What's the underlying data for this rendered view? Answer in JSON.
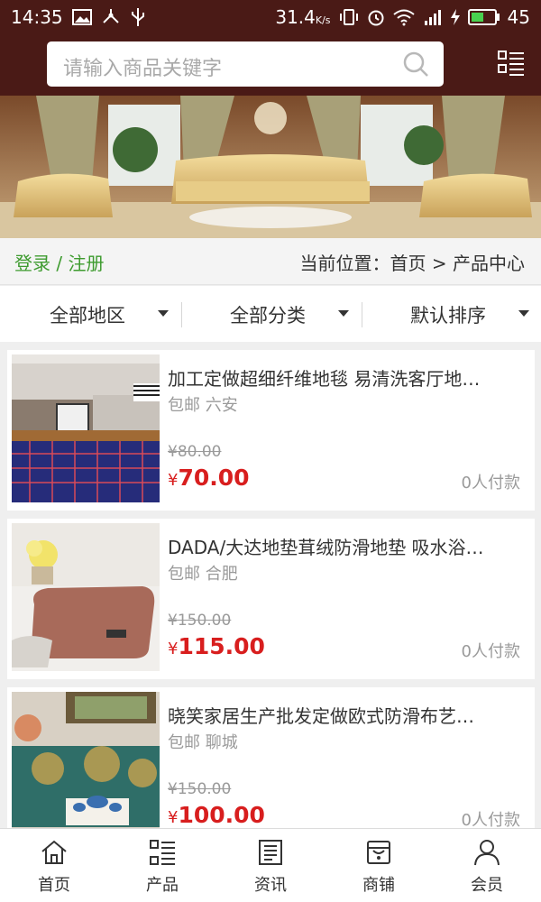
{
  "status_bar": {
    "time": "14:35",
    "speed": "31.4",
    "speed_unit": "K/s",
    "battery": "45"
  },
  "search": {
    "placeholder": "请输入商品关键字"
  },
  "auth": {
    "login_register": "登录 / 注册"
  },
  "breadcrumb": {
    "text": "当前位置：首页 > 产品中心"
  },
  "filters": [
    {
      "label": "全部地区"
    },
    {
      "label": "全部分类"
    },
    {
      "label": "默认排序"
    }
  ],
  "products": [
    {
      "title": "加工定做超细纤维地毯 易清洗客厅地…",
      "shipping": "包邮 六安",
      "old_price": "¥80.00",
      "currency": "¥",
      "price": "70.00",
      "paid": "0人付款"
    },
    {
      "title": "DADA/大达地垫茸绒防滑地垫 吸水浴…",
      "shipping": "包邮 合肥",
      "old_price": "¥150.00",
      "currency": "¥",
      "price": "115.00",
      "paid": "0人付款"
    },
    {
      "title": "晓笑家居生产批发定做欧式防滑布艺…",
      "shipping": "包邮 聊城",
      "old_price": "¥150.00",
      "currency": "¥",
      "price": "100.00",
      "paid": "0人付款"
    }
  ],
  "bottom_nav": [
    {
      "label": "首页",
      "icon": "home-icon"
    },
    {
      "label": "产品",
      "icon": "product-list-icon"
    },
    {
      "label": "资讯",
      "icon": "news-icon"
    },
    {
      "label": "商铺",
      "icon": "store-icon"
    },
    {
      "label": "会员",
      "icon": "member-icon"
    }
  ],
  "colors": {
    "header_bg": "#4a1a16",
    "accent_green": "#3e9b2f",
    "price_red": "#d81e1e"
  }
}
